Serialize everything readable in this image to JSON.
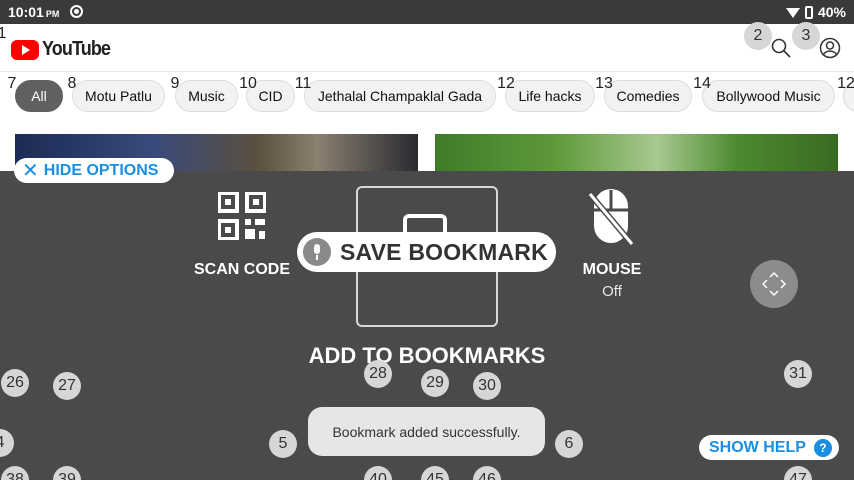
{
  "status_bar": {
    "time": "10:01",
    "ampm": "PM",
    "battery": "40%"
  },
  "header": {
    "logo_text": "YouTube"
  },
  "chips": [
    "All",
    "Motu Patlu",
    "Music",
    "CID",
    "Jethalal Champaklal Gada",
    "Life hacks",
    "Comedies",
    "Bollywood Music"
  ],
  "overlay": {
    "hide_options": "HIDE OPTIONS",
    "scan_code": "SCAN CODE",
    "mouse": "MOUSE",
    "mouse_state": "Off",
    "save_bookmark": "SAVE BOOKMARK",
    "add_to_bookmarks": "ADD TO BOOKMARKS",
    "toast": "Bookmark added successfully.",
    "show_help": "SHOW HELP",
    "help_symbol": "?"
  },
  "badges": {
    "b1": "1",
    "b2": "2",
    "b3": "3",
    "b4": "4",
    "b5": "5",
    "b6": "6",
    "b7": "7",
    "b8": "8",
    "b9": "9",
    "b10": "10",
    "b11": "11",
    "b12": "12",
    "b13": "13",
    "b14": "14",
    "b1x": "12",
    "b26": "26",
    "b27": "27",
    "b28": "28",
    "b29": "29",
    "b30": "30",
    "b31": "31",
    "b38": "38",
    "b39": "39",
    "b40": "40",
    "b45": "45",
    "b46": "46",
    "b47": "47"
  }
}
